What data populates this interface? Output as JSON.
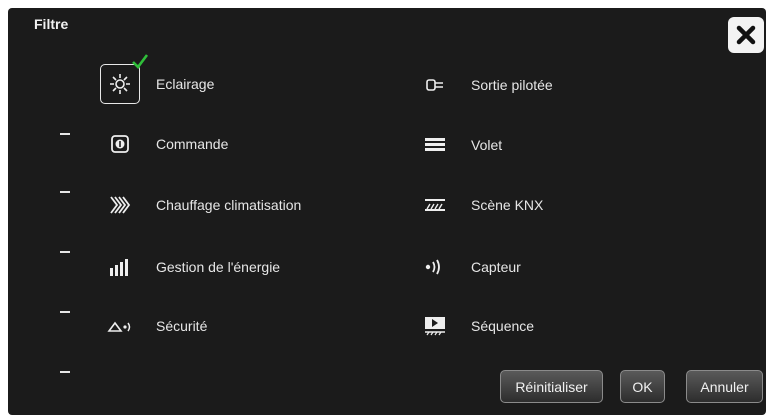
{
  "dialog": {
    "title": "Filtre",
    "close_icon": "close-icon"
  },
  "left_items": [
    {
      "label": "Eclairage",
      "icon": "light-icon",
      "selected": true
    },
    {
      "label": "Commande",
      "icon": "command-icon",
      "selected": false
    },
    {
      "label": "Chauffage climatisation",
      "icon": "heating-icon",
      "selected": false
    },
    {
      "label": "Gestion de l'énergie",
      "icon": "energy-icon",
      "selected": false
    },
    {
      "label": "Sécurité",
      "icon": "security-icon",
      "selected": false
    }
  ],
  "right_items": [
    {
      "label": "Sortie pilotée",
      "icon": "plug-icon",
      "selected": false
    },
    {
      "label": "Volet",
      "icon": "shutter-icon",
      "selected": false
    },
    {
      "label": "Scène KNX",
      "icon": "scene-icon",
      "selected": false
    },
    {
      "label": "Capteur",
      "icon": "sensor-icon",
      "selected": false
    },
    {
      "label": "Séquence",
      "icon": "sequence-icon",
      "selected": false
    }
  ],
  "buttons": {
    "reset": "Réinitialiser",
    "ok": "OK",
    "cancel": "Annuler"
  },
  "colors": {
    "background": "#1b1b1b",
    "text": "#e6e6e6",
    "check": "#2fbf3a"
  }
}
